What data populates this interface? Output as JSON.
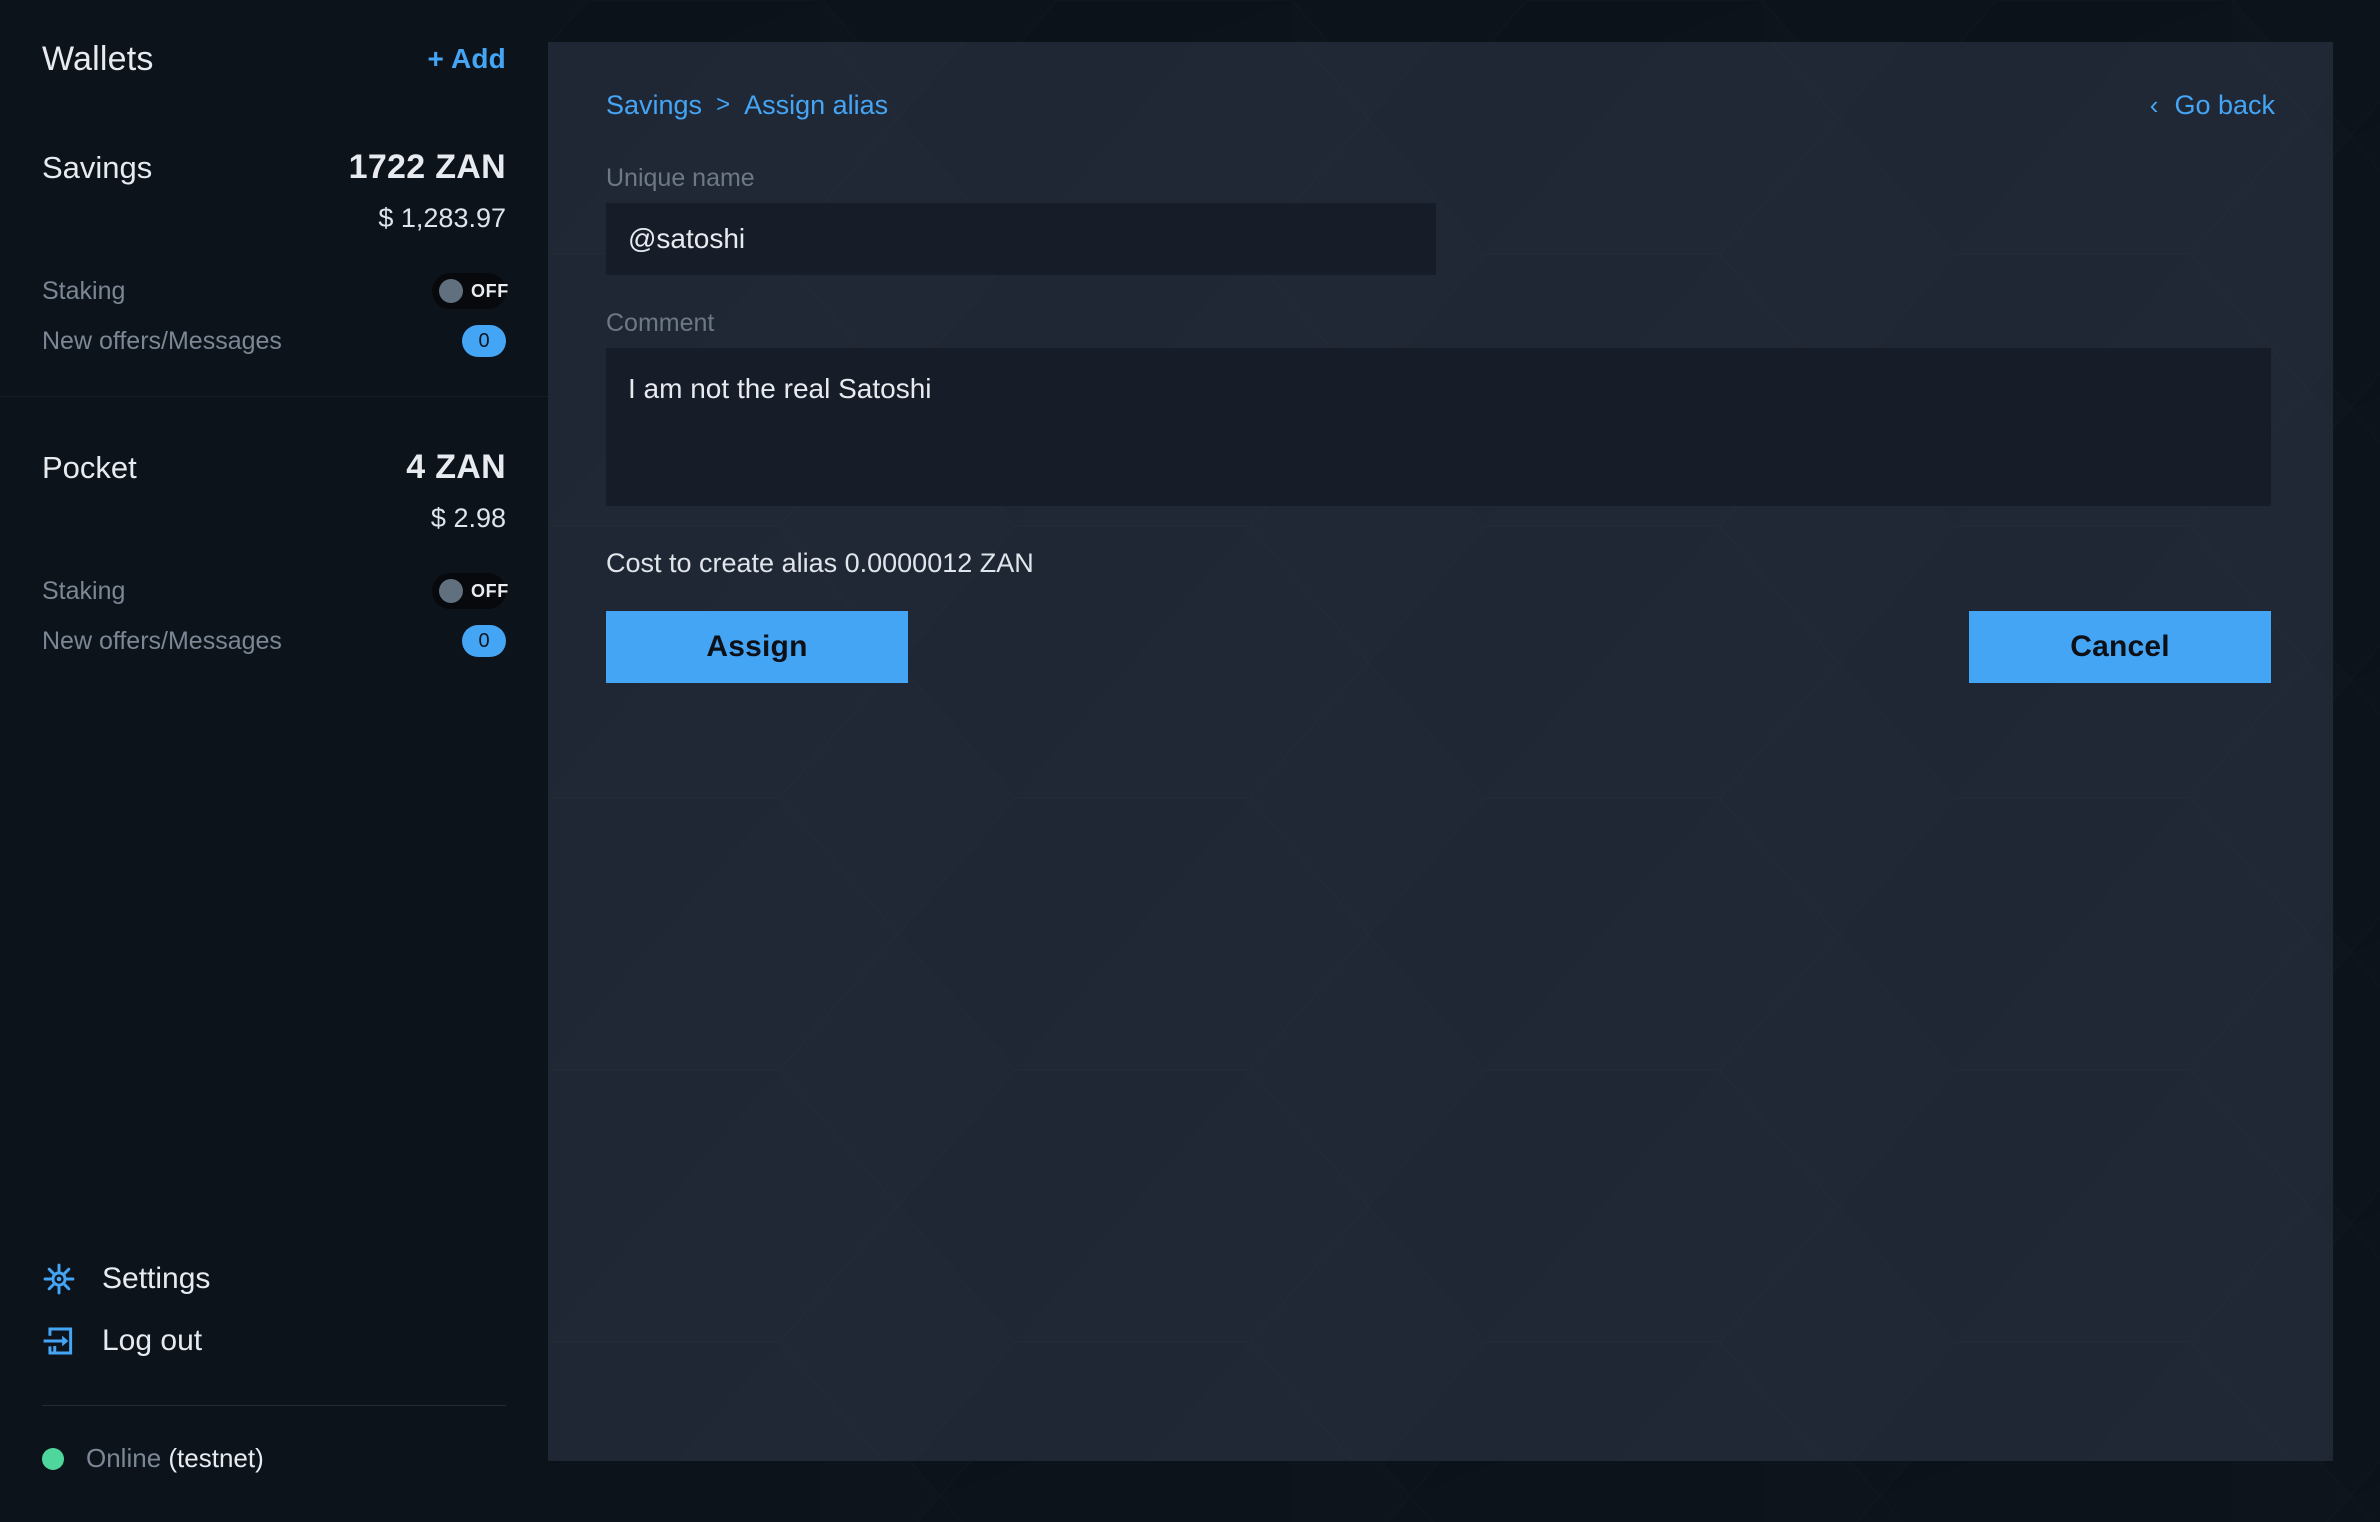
{
  "sidebar": {
    "title": "Wallets",
    "add_label": "+ Add",
    "wallets": [
      {
        "name": "Savings",
        "amount": "1722 ZAN",
        "fiat": "$ 1,283.97",
        "staking_label": "Staking",
        "staking_state": "OFF",
        "messages_label": "New offers/Messages",
        "messages_count": "0"
      },
      {
        "name": "Pocket",
        "amount": "4 ZAN",
        "fiat": "$ 2.98",
        "staking_label": "Staking",
        "staking_state": "OFF",
        "messages_label": "New offers/Messages",
        "messages_count": "0"
      }
    ],
    "settings_label": "Settings",
    "settings_icon": "gear-icon",
    "logout_label": "Log out",
    "logout_icon": "logout-icon",
    "status": {
      "state": "Online",
      "network": "(testnet)",
      "dot_color": "#4fd69c"
    }
  },
  "main": {
    "breadcrumb": {
      "parent": "Savings",
      "separator": ">",
      "current": "Assign alias"
    },
    "go_back": {
      "label": "Go back",
      "icon": "chevron-left-icon"
    },
    "form": {
      "unique_name_label": "Unique name",
      "unique_name_value": "@satoshi",
      "unique_name_placeholder": "@name",
      "comment_label": "Comment",
      "comment_value": "I am not the real Satoshi",
      "comment_placeholder": "Comment"
    },
    "cost_text": "Cost to create alias 0.0000012 ZAN",
    "assign_label": "Assign",
    "cancel_label": "Cancel"
  },
  "colors": {
    "accent": "#45a5f5",
    "panel_bg": "#212835",
    "app_bg": "#0d131b",
    "field_bg": "#171d28",
    "online": "#4fd69c",
    "muted_text": "#7b8794"
  }
}
